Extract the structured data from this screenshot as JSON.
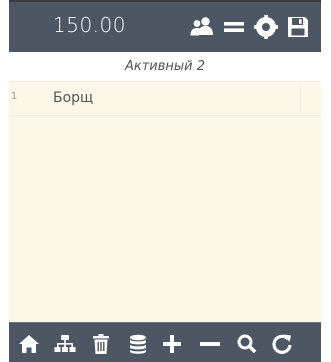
{
  "header": {
    "total": "150.00",
    "icons": [
      "users-icon",
      "menu-lines-icon",
      "settings-icon",
      "save-icon"
    ]
  },
  "order": {
    "title": "Активный 2",
    "items": [
      {
        "num": "1",
        "name": "Борщ"
      }
    ]
  },
  "toolbar": {
    "icons": [
      "home-icon",
      "sitemap-icon",
      "trash-icon",
      "database-icon",
      "plus-icon",
      "minus-icon",
      "search-icon",
      "refresh-icon"
    ]
  },
  "colors": {
    "bar": "#4d5663",
    "list_bg": "#fdf7e8",
    "icon": "#ffffff"
  }
}
